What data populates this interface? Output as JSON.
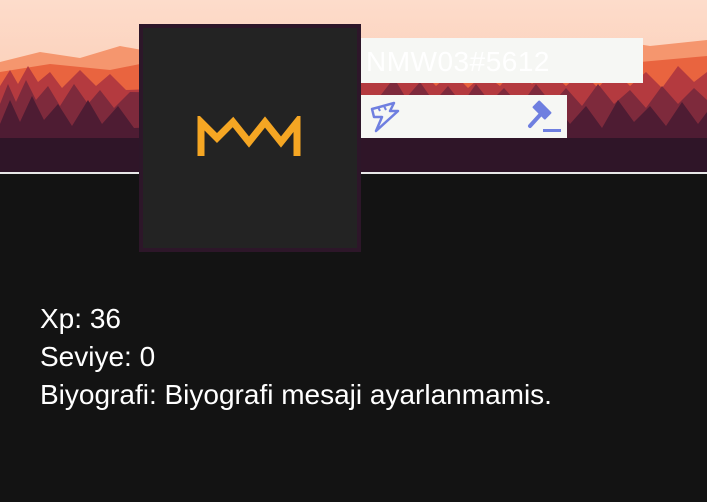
{
  "profile": {
    "username": "NMW03#5612",
    "avatar_logo": "NMW",
    "badges": [
      {
        "icon": "hypesquad-lightning-icon"
      },
      {
        "icon": "moderator-gavel-icon"
      }
    ]
  },
  "stats": {
    "xp_label": "Xp:",
    "xp_value": "36",
    "level_label": "Seviye:",
    "level_value": "0",
    "bio_label": "Biyografi:",
    "bio_value": "Biyografi mesaji ayarlanmamis."
  },
  "colors": {
    "background": "#131313",
    "sky": "#fdd5c1",
    "logo": "#f5a623",
    "badge_icon": "#6f7fe0"
  }
}
